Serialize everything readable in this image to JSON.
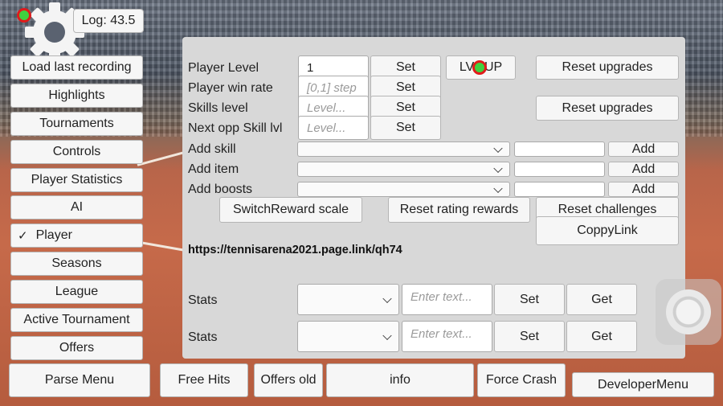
{
  "log": {
    "text": "Log: 43.5"
  },
  "sidebar": {
    "items": [
      {
        "label": "Load last recording"
      },
      {
        "label": "Highlights"
      },
      {
        "label": "Tournaments"
      },
      {
        "label": "Controls"
      },
      {
        "label": "Player Statistics"
      },
      {
        "label": "AI"
      },
      {
        "label": "Player",
        "selected": true,
        "check": "✓"
      },
      {
        "label": "Seasons"
      },
      {
        "label": "League"
      },
      {
        "label": "Active Tournament"
      },
      {
        "label": "Offers"
      }
    ]
  },
  "panel": {
    "player_level": {
      "label": "Player Level",
      "value": "1",
      "set": "Set"
    },
    "win_rate": {
      "label": "Player win rate",
      "placeholder": "[0,1] step",
      "set": "Set"
    },
    "skills_level": {
      "label": "Skills level",
      "placeholder": "Level...",
      "set": "Set"
    },
    "next_opp": {
      "label": "Next opp Skill lvl",
      "placeholder": "Level...",
      "set": "Set"
    },
    "lvl_up": "LVL UP",
    "reset_upgrades_1": "Reset upgrades",
    "reset_upgrades_2": "Reset upgrades",
    "add_skill": {
      "label": "Add skill",
      "add": "Add"
    },
    "add_item": {
      "label": "Add item",
      "add": "Add"
    },
    "add_boosts": {
      "label": "Add boosts",
      "add": "Add"
    },
    "switch_reward": "SwitchReward scale",
    "reset_rating": "Reset rating rewards",
    "reset_challenges": "Reset challenges",
    "copy_link": "CoppyLink",
    "link": "https://tennisarena2021.page.link/qh74",
    "stats_1": {
      "label": "Stats",
      "placeholder": "Enter text...",
      "set": "Set",
      "get": "Get"
    },
    "stats_2": {
      "label": "Stats",
      "placeholder": "Enter text...",
      "set": "Set",
      "get": "Get"
    }
  },
  "bottom": {
    "parse_menu": "Parse Menu",
    "free_hits": "Free Hits",
    "offers_old": "Offers old",
    "info": "info",
    "force_crash": "Force Crash",
    "developer_menu": "DeveloperMenu"
  },
  "colors": {
    "panel_bg": "#d8d8d8",
    "button_bg": "#f6f6f6",
    "marker_fill": "#3fd13f",
    "marker_ring": "#e01b1b"
  },
  "icons": {
    "gear": "gear-icon",
    "joystick": "joystick-icon",
    "marker": "touch-marker-icon",
    "check": "check-icon",
    "dropdown": "chevron-down-icon"
  }
}
